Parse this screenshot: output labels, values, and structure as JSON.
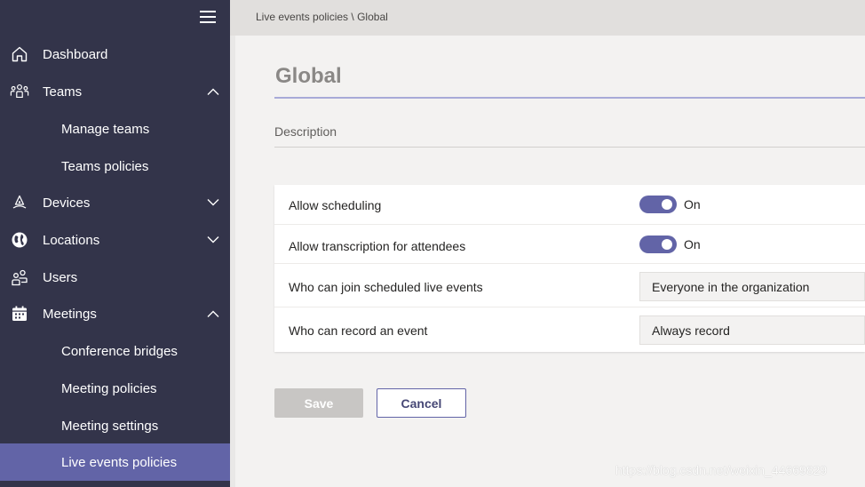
{
  "sidebar": {
    "items": [
      {
        "label": "Dashboard",
        "icon": "home-icon"
      },
      {
        "label": "Teams",
        "icon": "teams-icon",
        "expanded": true
      },
      {
        "label": "Manage teams"
      },
      {
        "label": "Teams policies"
      },
      {
        "label": "Devices",
        "icon": "devices-icon",
        "expanded": false
      },
      {
        "label": "Locations",
        "icon": "globe-icon",
        "expanded": false
      },
      {
        "label": "Users",
        "icon": "users-icon"
      },
      {
        "label": "Meetings",
        "icon": "calendar-icon",
        "expanded": true
      },
      {
        "label": "Conference bridges"
      },
      {
        "label": "Meeting policies"
      },
      {
        "label": "Meeting settings"
      },
      {
        "label": "Live events policies",
        "active": true
      }
    ]
  },
  "breadcrumb": {
    "parent": "Live events policies",
    "separator": "\\",
    "current": "Global"
  },
  "page": {
    "title": "Global",
    "description_placeholder": "Description"
  },
  "settings": [
    {
      "label": "Allow scheduling",
      "type": "toggle",
      "state": "On"
    },
    {
      "label": "Allow transcription for attendees",
      "type": "toggle",
      "state": "On"
    },
    {
      "label": "Who can join scheduled live events",
      "type": "dropdown",
      "value": "Everyone in the organization"
    },
    {
      "label": "Who can record an event",
      "type": "dropdown",
      "value": "Always record"
    }
  ],
  "actions": {
    "save_label": "Save",
    "cancel_label": "Cancel"
  },
  "watermark": "https://blog.csdn.net/weixin_44669829",
  "colors": {
    "sidebar_bg": "#33344a",
    "accent": "#6264a7",
    "page_bg": "#f3f2f1"
  }
}
